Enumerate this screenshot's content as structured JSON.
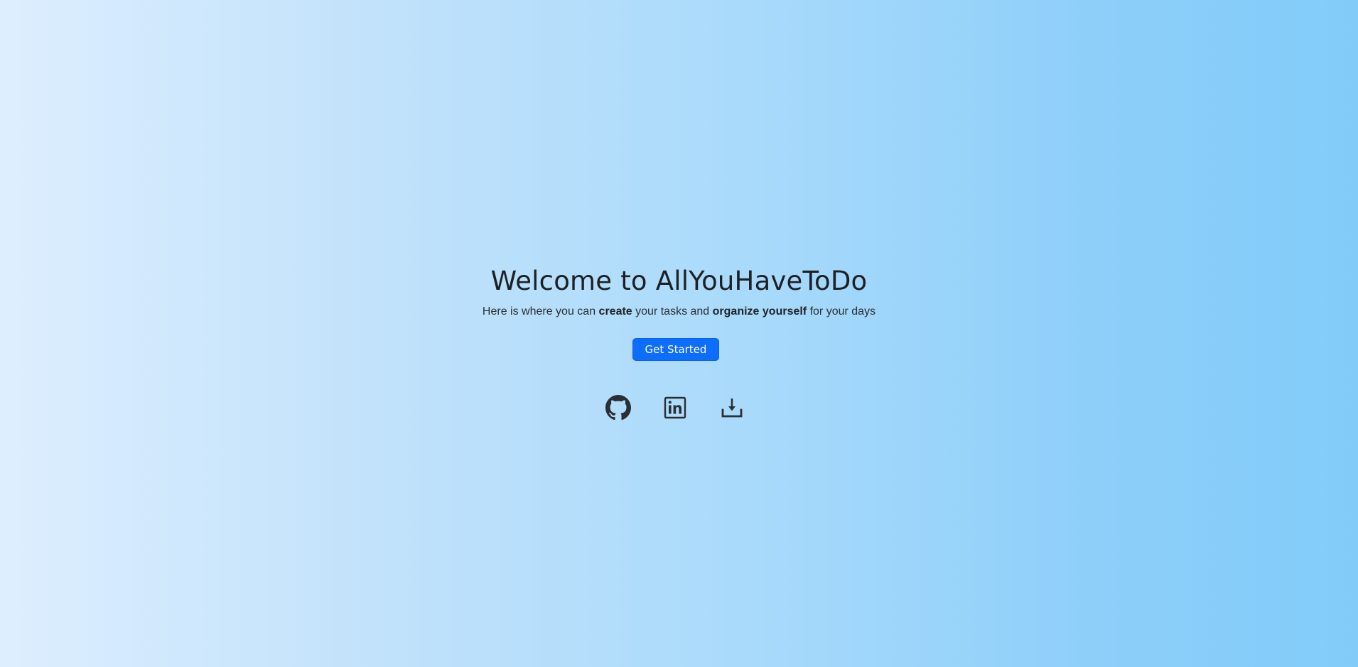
{
  "hero": {
    "title": "Welcome to AllYouHaveToDo",
    "subtitle": {
      "part1": "Here is where you can ",
      "strong1": "create",
      "part2": " your tasks and ",
      "strong2": "organize yourself",
      "part3": " for your days"
    },
    "cta_label": "Get Started"
  },
  "links": [
    {
      "icon": "github-icon"
    },
    {
      "icon": "linkedin-icon"
    },
    {
      "icon": "download-icon"
    }
  ],
  "colors": {
    "accent": "#0d6efd",
    "icon": "#2b2f33",
    "gradient_start": "#ddeeff",
    "gradient_end": "#82cbf9"
  }
}
